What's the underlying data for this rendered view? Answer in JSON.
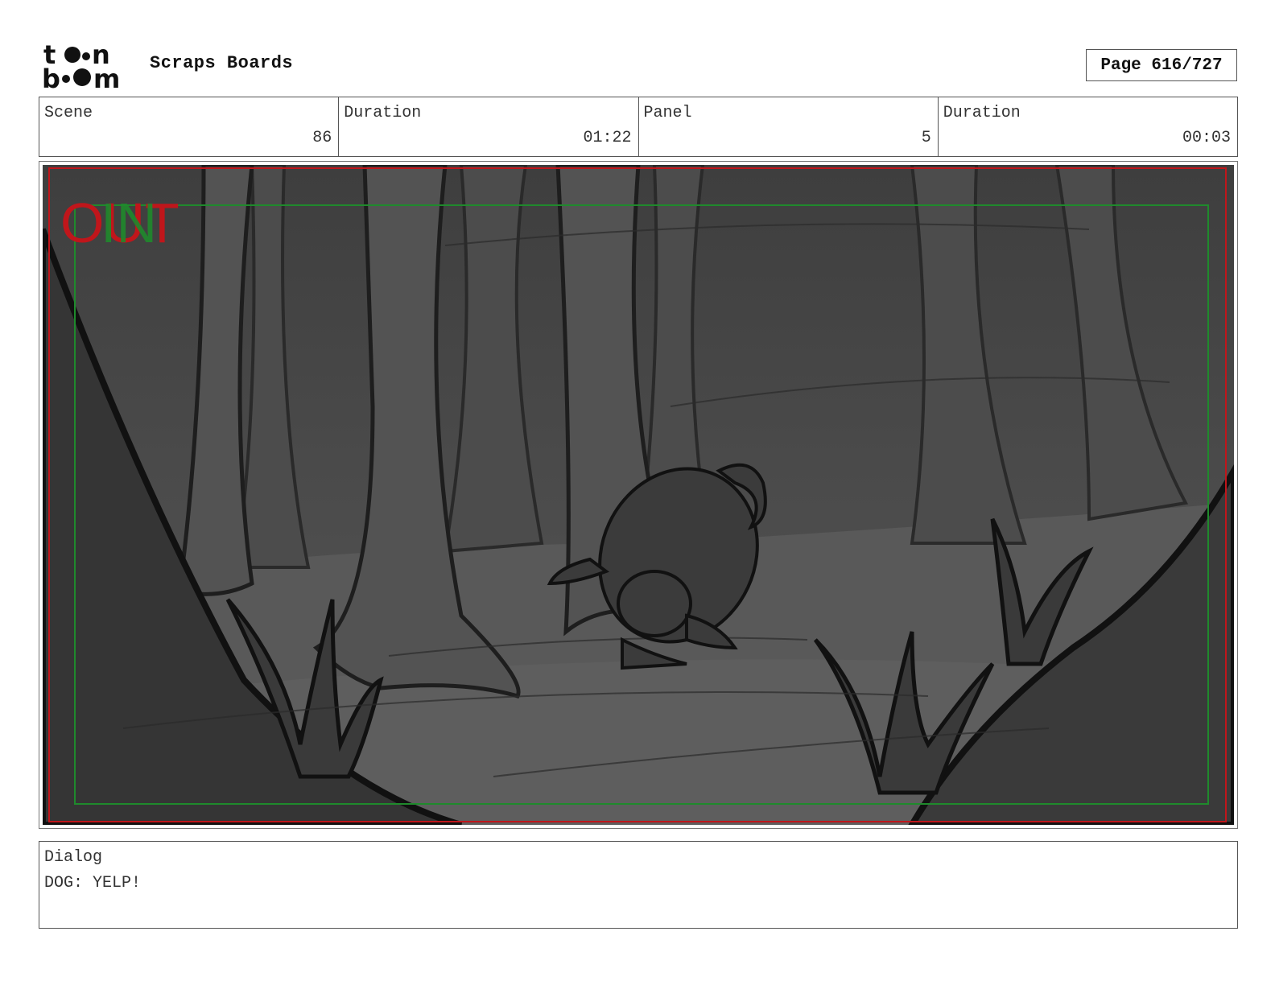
{
  "header": {
    "logo_text": "toonboom",
    "project_title": "Scraps Boards",
    "page_label": "Page 616/727"
  },
  "info": {
    "scene_label": "Scene",
    "scene_value": "86",
    "scene_duration_label": "Duration",
    "scene_duration_value": "01:22",
    "panel_label": "Panel",
    "panel_value": "5",
    "panel_duration_label": "Duration",
    "panel_duration_value": "00:03"
  },
  "panel": {
    "overlay_out": "OUT",
    "overlay_in": "IN",
    "colors": {
      "safe_frame_red": "#c0161b",
      "title_safe_green": "#1f8a2c"
    }
  },
  "dialog": {
    "label": "Dialog",
    "text": "DOG: YELP!"
  }
}
